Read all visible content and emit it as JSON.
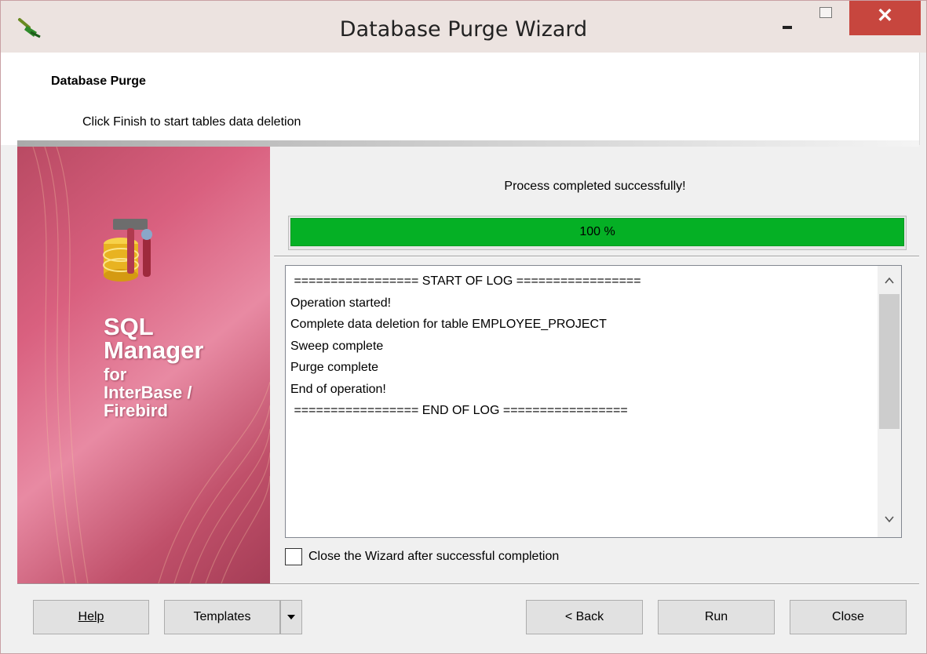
{
  "window": {
    "title": "Database Purge Wizard",
    "close_glyph": "✕"
  },
  "header": {
    "title": "Database Purge",
    "subtitle": "Click Finish to start tables data deletion"
  },
  "banner": {
    "line1": "SQL",
    "line2": "Manager",
    "line3": "for",
    "line4": "InterBase /",
    "line5": "Firebird"
  },
  "main": {
    "status": "Process completed successfully!",
    "progress": {
      "value": 1.0,
      "label": "100 %"
    },
    "log_lines": [
      " ================= START OF LOG =================",
      "Operation started!",
      "Complete data deletion for table EMPLOYEE_PROJECT",
      "Sweep complete",
      "Purge complete",
      "End of operation!",
      " ================= END OF LOG ================="
    ],
    "close_after_label": "Close the Wizard after successful completion",
    "close_after_checked": false
  },
  "footer": {
    "help": "Help",
    "templates": "Templates",
    "back": "< Back",
    "run": "Run",
    "close": "Close"
  },
  "icons": {
    "app": "broom-icon",
    "banner": "database-tools-icon",
    "dropdown": "chevron-down-icon",
    "scroll_up": "chevron-up-icon",
    "scroll_down": "chevron-down-icon"
  },
  "colors": {
    "progress_fill": "#05b025",
    "close_button": "#c7463e",
    "banner": "#d9607f"
  }
}
